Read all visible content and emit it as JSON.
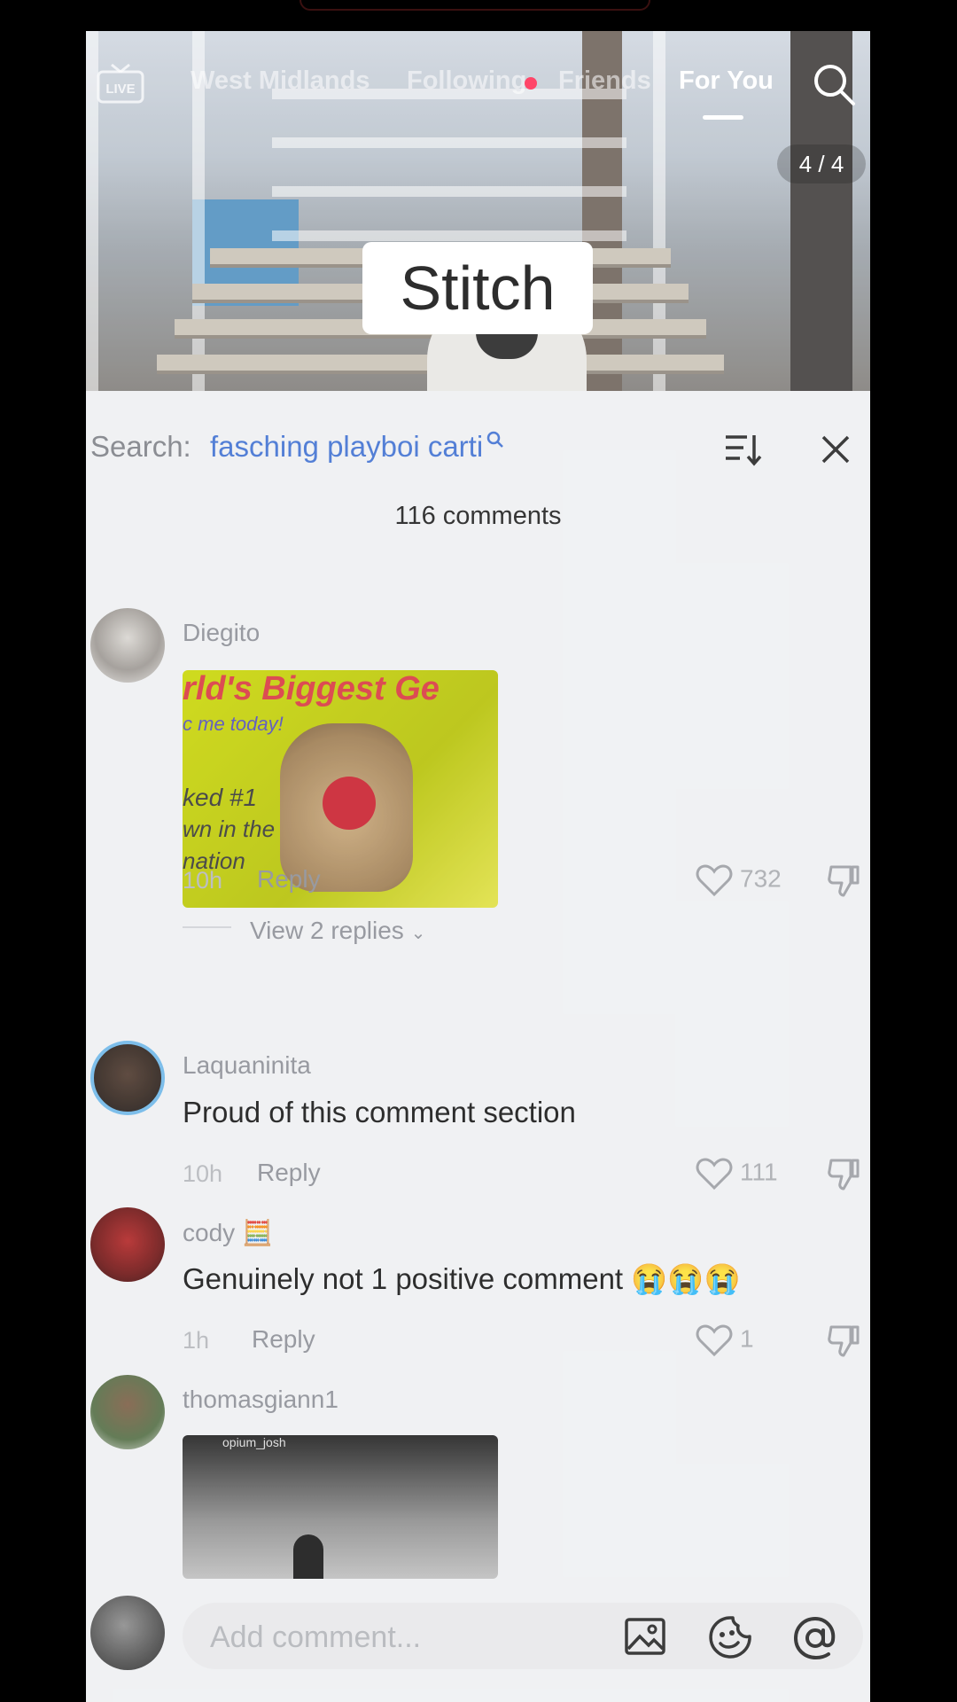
{
  "header": {
    "live_label": "LIVE",
    "tabs": [
      {
        "label": "West Midlands",
        "active": false
      },
      {
        "label": "Following",
        "active": false
      },
      {
        "label": "Friends",
        "active": false
      },
      {
        "label": "For You",
        "active": true
      }
    ],
    "search_icon": "search-icon",
    "counter": "4 / 4"
  },
  "video": {
    "overlay_label": "Stitch"
  },
  "comments_sheet": {
    "search_label": "Search:",
    "search_term": "fasching playboi carti",
    "count_label": "116 comments",
    "icons": {
      "sort": "sort-icon",
      "close": "close-icon"
    },
    "comments": [
      {
        "user": "Diegito",
        "media": {
          "line1": "rld's Biggest Ge",
          "line2": "c me today!",
          "line3": "ked #1",
          "line4": "wn in the",
          "line5": "nation"
        },
        "time": "10h",
        "reply": "Reply",
        "likes": "732",
        "view_replies": "View 2 replies"
      },
      {
        "user": "Laquaninita",
        "text": "Proud of this comment section",
        "time": "10h",
        "reply": "Reply",
        "likes": "111"
      },
      {
        "user": "cody",
        "user_emoji": "🧮",
        "text": "Genuinely not 1 positive comment 😭😭😭",
        "time": "1h",
        "reply": "Reply",
        "likes": "1"
      },
      {
        "user": "thomasgiann1",
        "media": {
          "caption": "opium_josh"
        }
      }
    ]
  },
  "composer": {
    "placeholder": "Add comment...",
    "icons": {
      "image": "image-icon",
      "sticker": "sticker-icon",
      "mention": "mention-icon"
    }
  },
  "colors": {
    "accent_link": "#3c6ed1",
    "live_dot": "#ff2d55",
    "sheet_bg": "#eef0f2"
  }
}
